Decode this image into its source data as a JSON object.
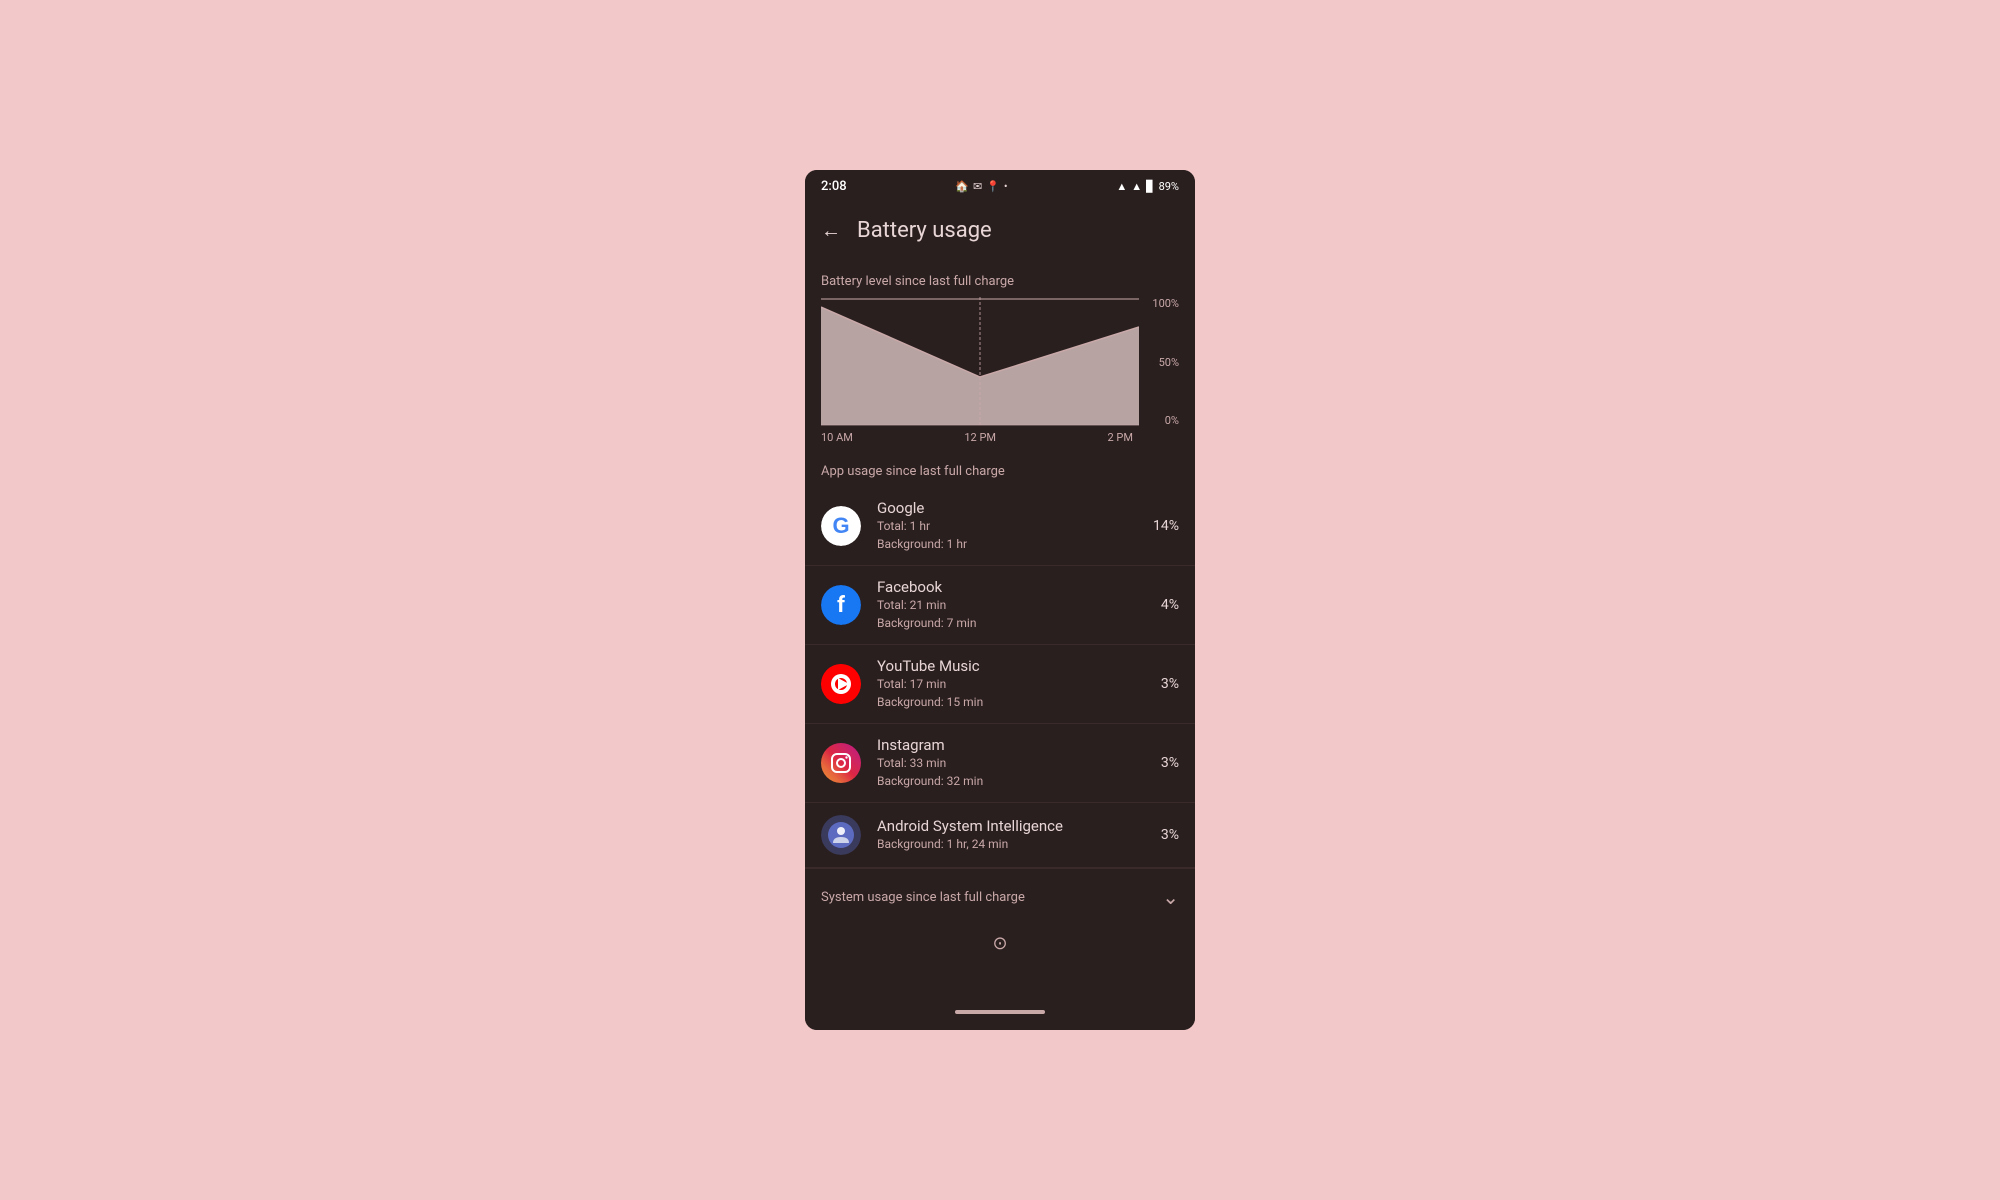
{
  "statusBar": {
    "time": "2:08",
    "batteryPercent": "89%",
    "icons": {
      "wifi": "▲",
      "signal": "▲",
      "battery": "🔋"
    }
  },
  "appBar": {
    "backLabel": "←",
    "title": "Battery usage"
  },
  "chart": {
    "sectionLabel": "Battery level since last full charge",
    "yLabels": [
      "100%",
      "50%",
      "0%"
    ],
    "xLabels": [
      "10 AM",
      "12 PM",
      "2 PM"
    ]
  },
  "appUsage": {
    "sectionTitle": "App usage since last full charge",
    "apps": [
      {
        "name": "Google",
        "detail1": "Total: 1 hr",
        "detail2": "Background: 1 hr",
        "percentage": "14%",
        "iconType": "google"
      },
      {
        "name": "Facebook",
        "detail1": "Total: 21 min",
        "detail2": "Background: 7 min",
        "percentage": "4%",
        "iconType": "facebook"
      },
      {
        "name": "YouTube Music",
        "detail1": "Total: 17 min",
        "detail2": "Background: 15 min",
        "percentage": "3%",
        "iconType": "youtubemusic"
      },
      {
        "name": "Instagram",
        "detail1": "Total: 33 min",
        "detail2": "Background: 32 min",
        "percentage": "3%",
        "iconType": "instagram"
      },
      {
        "name": "Android System Intelligence",
        "detail1": "Background: 1 hr, 24 min",
        "detail2": "",
        "percentage": "3%",
        "iconType": "asi"
      }
    ]
  },
  "systemUsage": {
    "label": "System usage since last full charge",
    "chevron": "⌄"
  },
  "bottomNav": {
    "indicator": ""
  }
}
